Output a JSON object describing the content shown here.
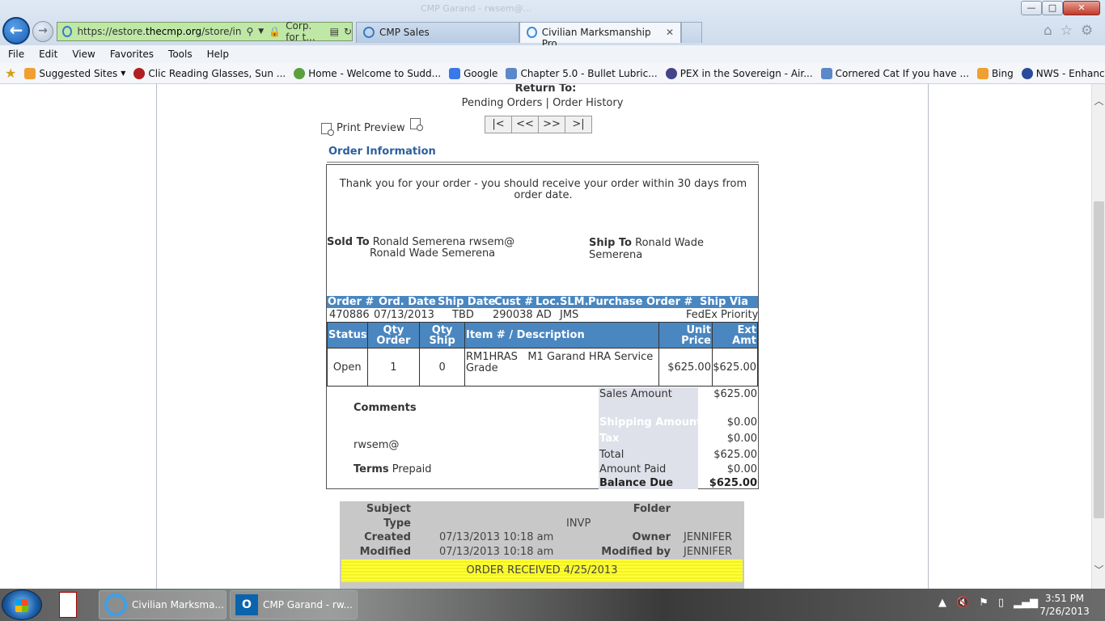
{
  "browser": {
    "title_text": "CMP Garand - rwsem@...",
    "url_prefix": "https://estore.",
    "url_domain": "thecmp.org",
    "url_suffix": "/store/in",
    "security_label": "Corp. for t...",
    "tabs": [
      {
        "label": "CMP Sales"
      },
      {
        "label": "Civilian Marksmanship Pro..."
      }
    ],
    "window_buttons": {
      "minimize": "—",
      "maximize": "□",
      "close": "✕"
    }
  },
  "menu": [
    "File",
    "Edit",
    "View",
    "Favorites",
    "Tools",
    "Help"
  ],
  "favorites": [
    {
      "label": "Suggested Sites",
      "color": "#f0a030"
    },
    {
      "label": "Clic Reading Glasses, Sun ...",
      "color": "#b02020"
    },
    {
      "label": "Home - Welcome to Sudd...",
      "color": "#5aa03c"
    },
    {
      "label": "Google",
      "color": "#3b78e7"
    },
    {
      "label": "Chapter 5.0 - Bullet Lubric...",
      "color": "#5a88c8"
    },
    {
      "label": "PEX in the Sovereign - Air...",
      "color": "#444488"
    },
    {
      "label": "Cornered Cat  If you have ...",
      "color": "#5a88c8"
    },
    {
      "label": "Bing",
      "color": "#f0a030"
    },
    {
      "label": "NWS - Enhanced Doppler ...",
      "color": "#2a4a9a"
    }
  ],
  "page": {
    "return_to": "Return To:",
    "pending_orders": "Pending Orders",
    "separator": "|",
    "order_history": "Order History",
    "print_preview": "Print Preview",
    "pager": [
      "|<",
      "<<",
      ">>",
      ">|"
    ],
    "order_info_title": "Order Information",
    "thanks": "Thank you for your order - you should receive your order within 30 days from order date.",
    "sold_to_label": "Sold To",
    "sold_to_line1": "Ronald Semerena rwsem@",
    "sold_to_line2": "Ronald Wade Semerena",
    "ship_to_label": "Ship To",
    "ship_to_value": "Ronald Wade Semerena",
    "order_headers": {
      "order_no": "Order #",
      "ord_date": "Ord. Date",
      "ship_date": "Ship Date",
      "cust_no": "Cust #",
      "loc": "Loc.",
      "slm": "SLM.",
      "po": "Purchase Order #",
      "ship_via": "Ship Via"
    },
    "order_values": {
      "order_no": "470886",
      "ord_date": "07/13/2013",
      "ship_date": "TBD",
      "cust_no": "290038",
      "loc": "AD",
      "slm": "JMS",
      "po": "",
      "ship_via": "FedEx Priority"
    },
    "item_headers": {
      "status": "Status",
      "qty_order_1": "Qty",
      "qty_order_2": "Order",
      "qty_ship_1": "Qty",
      "qty_ship_2": "Ship",
      "item": "Item # / Description",
      "unit_1": "Unit",
      "unit_2": "Price",
      "ext_1": "Ext",
      "ext_2": "Amt"
    },
    "items": [
      {
        "status": "Open",
        "qty_order": "1",
        "qty_ship": "0",
        "item_line1": "RM1HRAS   M1 Garand HRA Service",
        "item_line2": "Grade",
        "unit_price": "$625.00",
        "ext_amt": "$625.00"
      }
    ],
    "comments_label": "Comments",
    "comments_email": "rwsem@",
    "terms_label": "Terms",
    "terms_value": "Prepaid",
    "totals": {
      "sales_amount_label": "Sales Amount",
      "sales_amount": "$625.00",
      "shipping_label": "Shipping Amount",
      "shipping": "$0.00",
      "tax_label": "Tax",
      "tax": "$0.00",
      "total_label": "Total",
      "total": "$625.00",
      "paid_label": "Amount Paid",
      "paid": "$0.00",
      "balance_label": "Balance Due",
      "balance": "$625.00"
    },
    "note": {
      "subject_label": "Subject",
      "folder_label": "Folder",
      "type_label": "Type",
      "type_value": "INVP",
      "created_label": "Created",
      "created_value": "07/13/2013 10:18 am",
      "owner_label": "Owner",
      "owner_value": "JENNIFER",
      "modified_label": "Modified",
      "modified_value": "07/13/2013 10:18 am",
      "modified_by_label": "Modified by",
      "modified_by_value": "JENNIFER",
      "banner": "ORDER RECEIVED 4/25/2013"
    }
  },
  "taskbar": {
    "items": [
      {
        "label": "Civilian Marksma..."
      },
      {
        "label": "CMP Garand - rw..."
      }
    ],
    "clock_time": "3:51 PM",
    "clock_date": "7/26/2013"
  }
}
